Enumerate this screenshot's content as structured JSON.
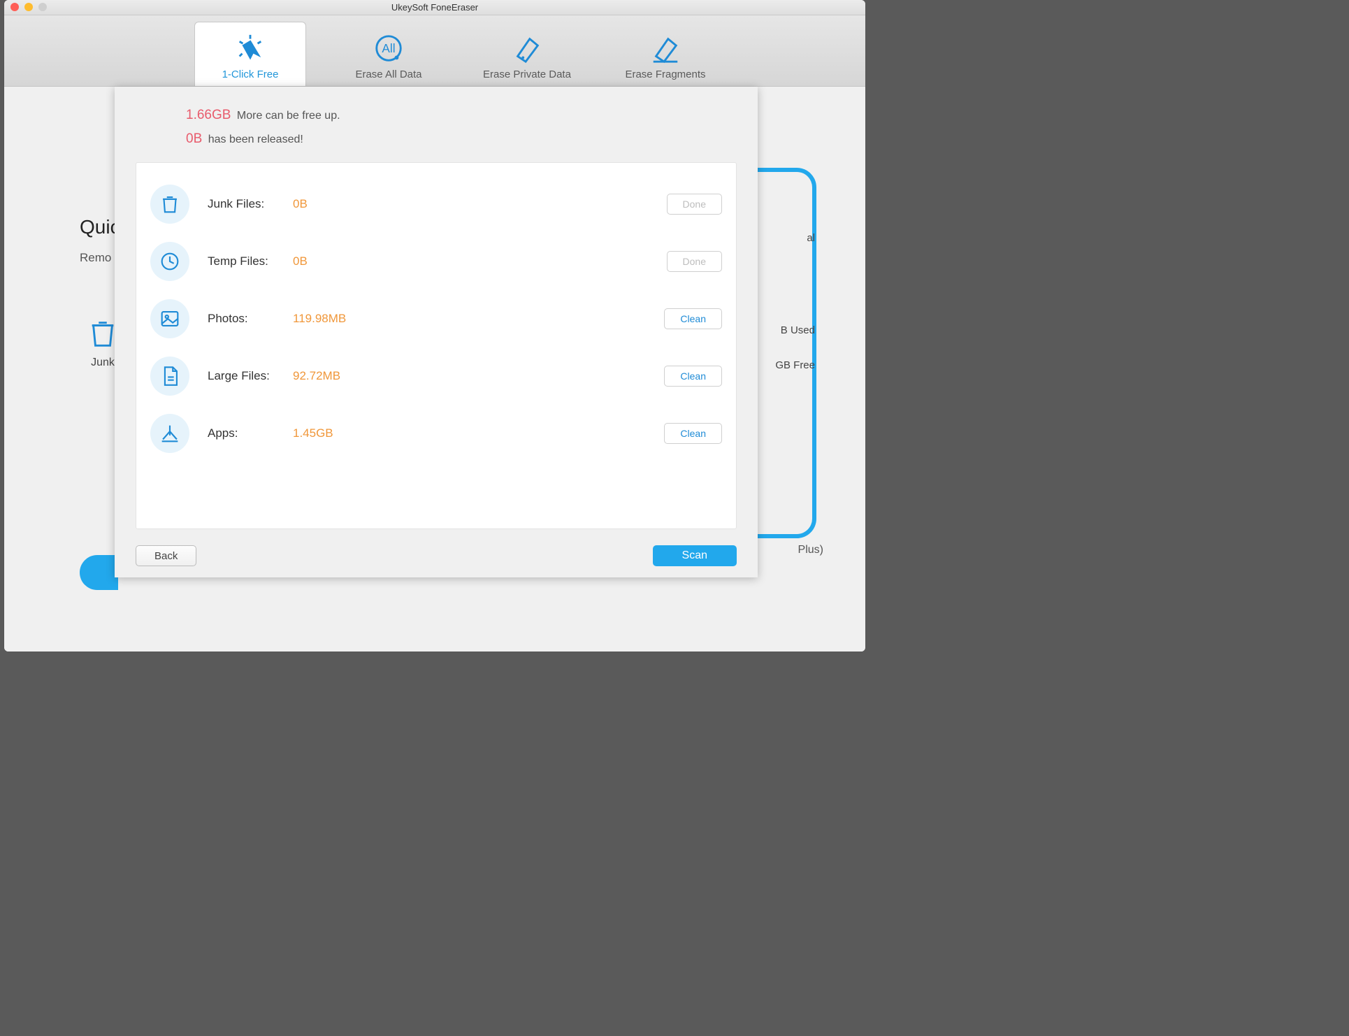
{
  "window": {
    "title": "UkeySoft FoneEraser"
  },
  "tabs": [
    {
      "label": "1-Click Free",
      "icon": "click-free-icon",
      "active": true
    },
    {
      "label": "Erase All Data",
      "icon": "erase-all-icon",
      "active": false
    },
    {
      "label": "Erase Private Data",
      "icon": "erase-private-icon",
      "active": false
    },
    {
      "label": "Erase Fragments",
      "icon": "erase-fragments-icon",
      "active": false
    }
  ],
  "background": {
    "heading_prefix": "Quic",
    "sub_prefix": "Remo",
    "junk_label_prefix": "Junk",
    "used_suffix": "B Used",
    "free_suffix": "GB Free",
    "model_suffix": " Plus)",
    "al_suffix": "al"
  },
  "panel": {
    "header": {
      "more_value": "1.66GB",
      "more_text": "More can be free up.",
      "released_value": "0B",
      "released_text": "has been released!"
    },
    "rows": [
      {
        "name": "junk-files",
        "label": "Junk Files:",
        "value": "0B",
        "button": "Done",
        "button_state": "done",
        "icon": "trash-icon"
      },
      {
        "name": "temp-files",
        "label": "Temp Files:",
        "value": "0B",
        "button": "Done",
        "button_state": "done",
        "icon": "clock-icon"
      },
      {
        "name": "photos",
        "label": "Photos:",
        "value": "119.98MB",
        "button": "Clean",
        "button_state": "clean",
        "icon": "photo-icon"
      },
      {
        "name": "large-files",
        "label": "Large Files:",
        "value": "92.72MB",
        "button": "Clean",
        "button_state": "clean",
        "icon": "file-icon"
      },
      {
        "name": "apps",
        "label": "Apps:",
        "value": "1.45GB",
        "button": "Clean",
        "button_state": "clean",
        "icon": "app-icon"
      }
    ],
    "footer": {
      "back": "Back",
      "scan": "Scan"
    }
  }
}
